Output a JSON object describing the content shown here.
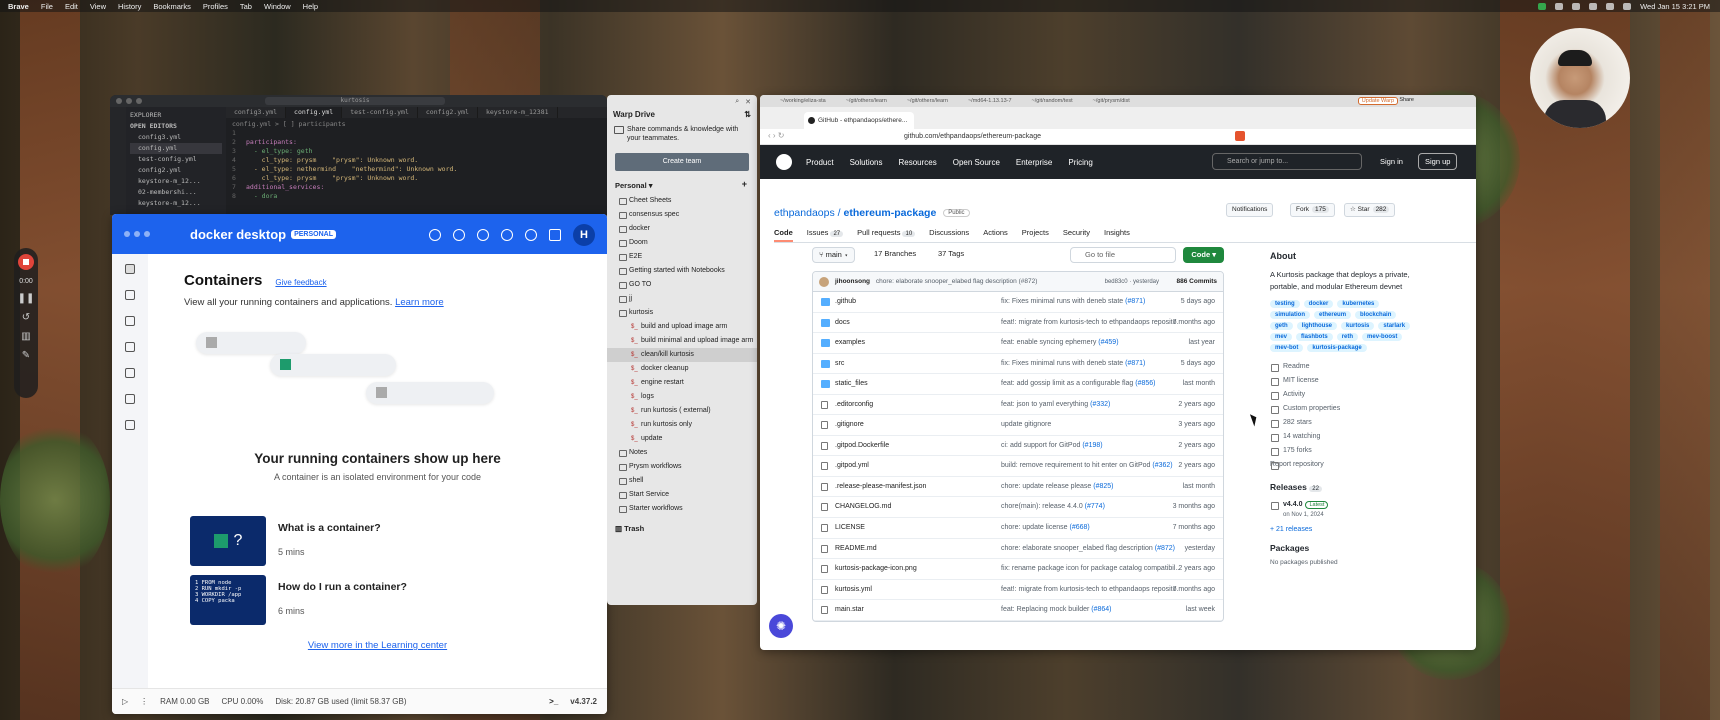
{
  "menubar": {
    "app": "Brave",
    "items": [
      "File",
      "Edit",
      "View",
      "History",
      "Bookmarks",
      "Profiles",
      "Tab",
      "Window",
      "Help"
    ],
    "datetime": "Wed Jan 15  3:21 PM"
  },
  "recorder": {
    "time": "0:00"
  },
  "vscode": {
    "search": "kurtosis",
    "explorer_title": "EXPLORER",
    "open_editors": "OPEN EDITORS",
    "explorer_items": [
      "config3.yml",
      "config.yml",
      "test-config.yml",
      "config2.yml",
      "keystore-m_12...",
      "02-membershi...",
      "keystore-m_12..."
    ],
    "tabs": [
      "config3.yml",
      "config.yml",
      "test-config.yml",
      "config2.yml",
      "keystore-m_12381"
    ],
    "breadcrumb": "config.yml > [ ] participants",
    "code": [
      {
        "n": "1",
        "t": ""
      },
      {
        "n": "2",
        "t": "participants:"
      },
      {
        "n": "3",
        "t": "  - el_type: geth"
      },
      {
        "n": "4",
        "t": "    cl_type: prysm    \"prysm\": Unknown word."
      },
      {
        "n": "5",
        "t": "  - el_type: nethermind    \"nethermind\": Unknown word."
      },
      {
        "n": "6",
        "t": "    cl_type: prysm    \"prysm\": Unknown word."
      },
      {
        "n": "7",
        "t": "additional_services:"
      },
      {
        "n": "8",
        "t": "  - dora"
      }
    ]
  },
  "docker": {
    "brand": "docker desktop",
    "badge": "PERSONAL",
    "avatar": "H",
    "title": "Containers",
    "feedback": "Give feedback",
    "subtitle": "View all your running containers and applications.",
    "learn_more": "Learn more",
    "empty_title": "Your running containers show up here",
    "empty_sub": "A container is an isolated environment for your code",
    "cards": [
      {
        "title": "What is a container?",
        "mins": "5 mins",
        "glyph": "?"
      },
      {
        "title": "How do I run a container?",
        "mins": "6 mins",
        "code": [
          "1  FROM node",
          "2  RUN mkdir -p",
          "3  WORKDIR /app",
          "4  COPY packa"
        ]
      }
    ],
    "learning": "View more in the Learning center",
    "footer": {
      "ram": "RAM 0.00 GB",
      "cpu": "CPU 0.00%",
      "disk": "Disk: 20.87 GB used (limit 58.37 GB)",
      "version": "v4.37.2"
    }
  },
  "warp": {
    "title": "Warp Drive",
    "share": "Share commands & knowledge with your teammates.",
    "create_team": "Create team",
    "personal": "Personal",
    "items": [
      {
        "l": "Cheet Sheets",
        "sub": false
      },
      {
        "l": "consensus spec",
        "sub": false
      },
      {
        "l": "docker",
        "sub": false
      },
      {
        "l": "Doom",
        "sub": false
      },
      {
        "l": "E2E",
        "sub": false
      },
      {
        "l": "Getting started with Notebooks",
        "sub": false
      },
      {
        "l": "GO TO",
        "sub": false
      },
      {
        "l": "jj",
        "sub": false
      },
      {
        "l": "kurtosis",
        "sub": false
      },
      {
        "l": "build and upload image arm",
        "sub": true
      },
      {
        "l": "build minimal and upload image arm",
        "sub": true
      },
      {
        "l": "clean/kill kurtosis",
        "sub": true,
        "sel": true
      },
      {
        "l": "docker cleanup",
        "sub": true
      },
      {
        "l": "engine restart",
        "sub": true
      },
      {
        "l": "logs",
        "sub": true
      },
      {
        "l": "run kurtosis ( external)",
        "sub": true
      },
      {
        "l": "run kurtosis only",
        "sub": true
      },
      {
        "l": "update",
        "sub": true
      },
      {
        "l": "Notes",
        "sub": false
      },
      {
        "l": "Prysm workflows",
        "sub": false
      },
      {
        "l": "shell",
        "sub": false
      },
      {
        "l": "Start Service",
        "sub": false
      },
      {
        "l": "Starter workflows",
        "sub": false
      }
    ],
    "trash": "Trash"
  },
  "browser": {
    "tab_paths": [
      "~/working/eliza-sta",
      "~/git/others/learn",
      "~/git/others/learn",
      "~/md64-1.13.13-7",
      "~/git/random/test",
      "~/git/prysm/dist"
    ],
    "update": "Update Warp",
    "share": "Share",
    "tab": "GitHub - ethpandaops/ethere...",
    "url": "github.com/ethpandaops/ethereum-package",
    "nav": [
      "Product",
      "Solutions",
      "Resources",
      "Open Source",
      "Enterprise",
      "Pricing"
    ],
    "search": "Search or jump to...",
    "signin": "Sign in",
    "signup": "Sign up",
    "owner": "ethpandaops",
    "repo": "ethereum-package",
    "visibility": "Public",
    "notifications": "Notifications",
    "fork": "Fork",
    "fork_count": "175",
    "star": "Star",
    "star_count": "282",
    "tabs": [
      {
        "l": "Code",
        "c": ""
      },
      {
        "l": "Issues",
        "c": "27"
      },
      {
        "l": "Pull requests",
        "c": "10"
      },
      {
        "l": "Discussions",
        "c": ""
      },
      {
        "l": "Actions",
        "c": ""
      },
      {
        "l": "Projects",
        "c": ""
      },
      {
        "l": "Security",
        "c": ""
      },
      {
        "l": "Insights",
        "c": ""
      }
    ],
    "branch": "main",
    "branches": "17 Branches",
    "tags": "37 Tags",
    "goto": "Go to file",
    "code": "Code",
    "commit": {
      "author": "jihoonsong",
      "msg": "chore: elaborate snooper_elabed flag description (#872)",
      "hash": "bed83c0 · yesterday",
      "count": "886 Commits"
    },
    "files": [
      {
        "n": ".github",
        "t": "folder",
        "m": "fix: Fixes minimal runs with deneb state",
        "p": "(#871)",
        "d": "5 days ago"
      },
      {
        "n": "docs",
        "t": "folder",
        "m": "feat!: migrate from kurtosis-tech to ethpandaops reposito...",
        "p": "",
        "d": "7 months ago"
      },
      {
        "n": "examples",
        "t": "folder",
        "m": "feat: enable syncing ephemery",
        "p": "(#459)",
        "d": "last year"
      },
      {
        "n": "src",
        "t": "folder",
        "m": "fix: Fixes minimal runs with deneb state",
        "p": "(#871)",
        "d": "5 days ago"
      },
      {
        "n": "static_files",
        "t": "folder",
        "m": "feat: add gossip limit as a configurable flag",
        "p": "(#856)",
        "d": "last month"
      },
      {
        "n": ".editorconfig",
        "t": "file",
        "m": "feat: json to yaml everything",
        "p": "(#332)",
        "d": "2 years ago"
      },
      {
        "n": ".gitignore",
        "t": "file",
        "m": "update gitignore",
        "p": "",
        "d": "3 years ago"
      },
      {
        "n": ".gitpod.Dockerfile",
        "t": "file",
        "m": "ci: add support for GitPod",
        "p": "(#198)",
        "d": "2 years ago"
      },
      {
        "n": ".gitpod.yml",
        "t": "file",
        "m": "build: remove requirement to hit enter on GitPod",
        "p": "(#362)",
        "d": "2 years ago"
      },
      {
        "n": ".release-please-manifest.json",
        "t": "file",
        "m": "chore: update release please",
        "p": "(#825)",
        "d": "last month"
      },
      {
        "n": "CHANGELOG.md",
        "t": "file",
        "m": "chore(main): release 4.4.0",
        "p": "(#774)",
        "d": "3 months ago"
      },
      {
        "n": "LICENSE",
        "t": "file",
        "m": "chore: update license",
        "p": "(#668)",
        "d": "7 months ago"
      },
      {
        "n": "README.md",
        "t": "file",
        "m": "chore: elaborate snooper_elabed flag description",
        "p": "(#872)",
        "d": "yesterday"
      },
      {
        "n": "kurtosis-package-icon.png",
        "t": "file",
        "m": "fix: rename package icon for package catalog compatibil...",
        "p": "",
        "d": "2 years ago"
      },
      {
        "n": "kurtosis.yml",
        "t": "file",
        "m": "feat!: migrate from kurtosis-tech to ethpandaops reposito...",
        "p": "",
        "d": "7 months ago"
      },
      {
        "n": "main.star",
        "t": "file",
        "m": "feat: Replacing mock builder",
        "p": "(#864)",
        "d": "last week"
      }
    ],
    "about": {
      "title": "About",
      "desc": "A Kurtosis package that deploys a private, portable, and modular Ethereum devnet",
      "topics": [
        "testing",
        "docker",
        "kubernetes",
        "simulation",
        "ethereum",
        "blockchain",
        "geth",
        "lighthouse",
        "kurtosis",
        "starlark",
        "mev",
        "flashbots",
        "reth",
        "mev-boost",
        "mev-bot",
        "kurtosis-package"
      ],
      "links": [
        {
          "l": "Readme"
        },
        {
          "l": "MIT license"
        },
        {
          "l": "Activity"
        },
        {
          "l": "Custom properties"
        },
        {
          "l": "282 stars",
          "b": "282"
        },
        {
          "l": "14 watching"
        },
        {
          "l": "175 forks"
        }
      ],
      "report": "Report repository",
      "releases": "Releases",
      "releases_count": "22",
      "release_tag": "v4.4.0",
      "latest": "Latest",
      "release_date": "on Nov 1, 2024",
      "more_releases": "+ 21 releases",
      "packages": "Packages",
      "no_packages": "No packages published"
    }
  }
}
